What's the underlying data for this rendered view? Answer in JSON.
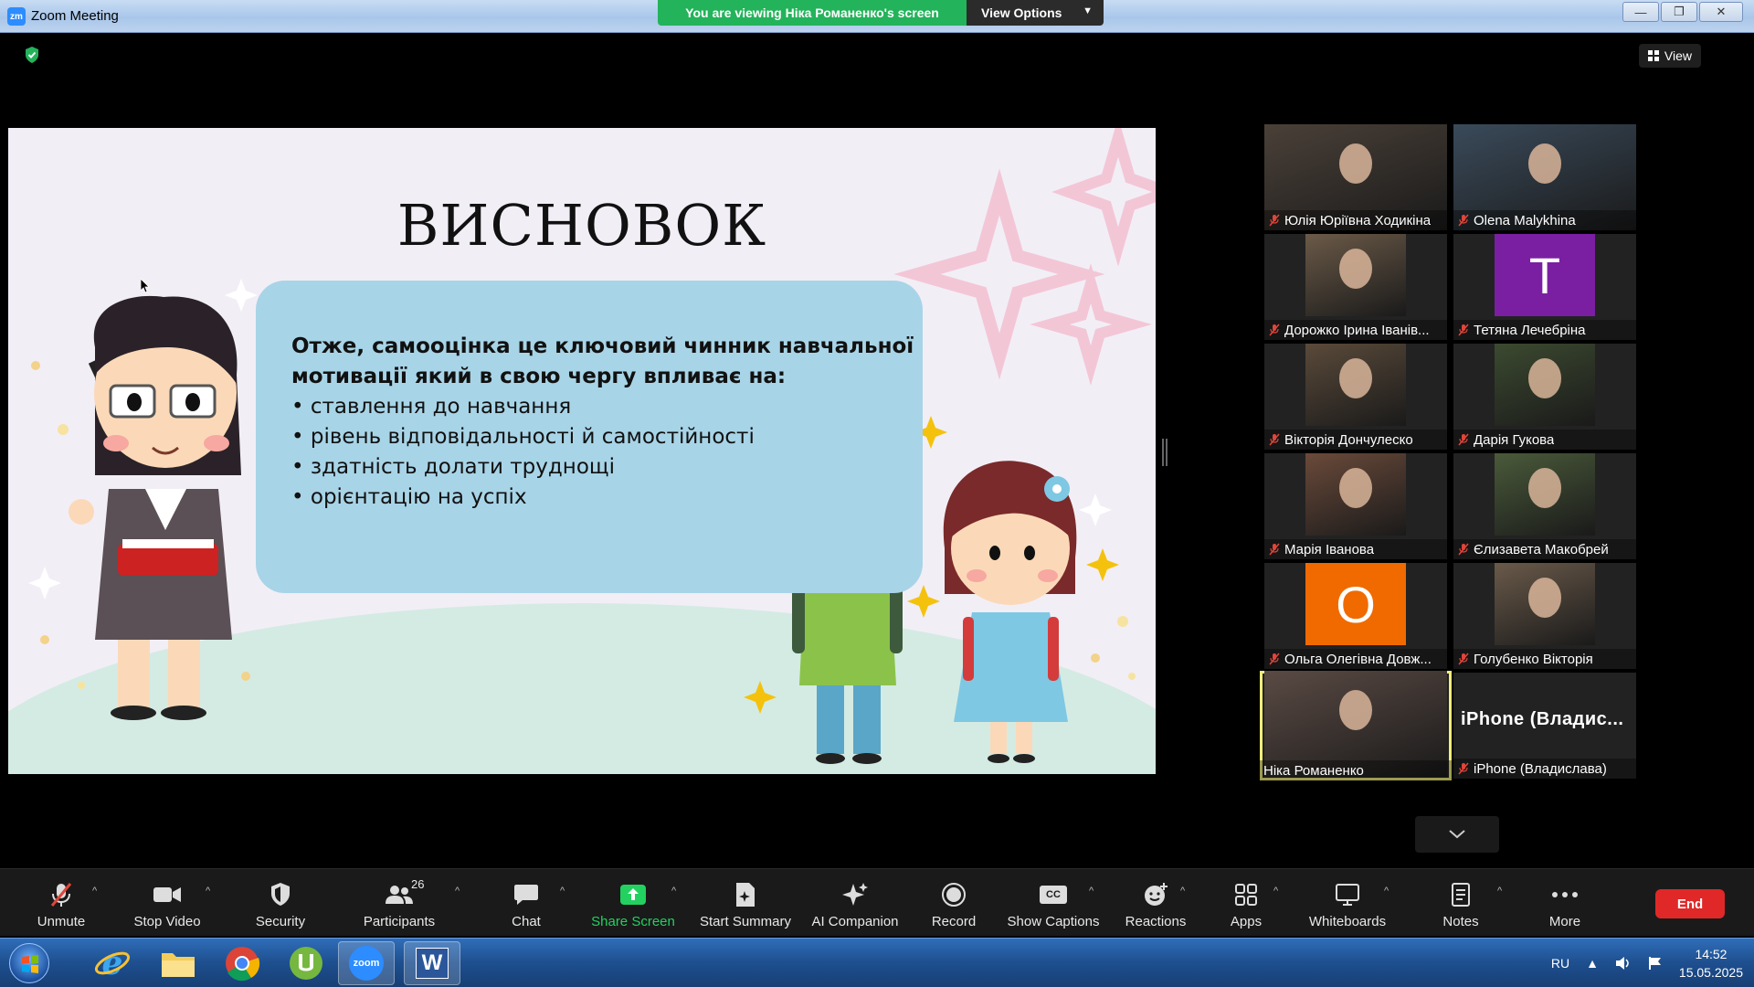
{
  "window": {
    "app_logo": "zm",
    "title": "Zoom Meeting",
    "viewing_banner": "You are viewing Ніка Романенко's screen",
    "view_options": "View Options",
    "view_button": "View"
  },
  "slide": {
    "title": "ВИСНОВОК",
    "lead": "Отже, самооцінка це ключовий чинник навчальної мотивації який в свою чергу впливає на:",
    "bullets": [
      "ставлення до навчання",
      "рівень відповідальності й самостійності",
      "здатність долати труднощі",
      "орієнтацію на успіх"
    ]
  },
  "gallery": {
    "participants": [
      {
        "name": "Юлія Юріївна Ходикіна",
        "kind": "video"
      },
      {
        "name": "Olena Malykhina",
        "kind": "video"
      },
      {
        "name": "Дорожко Ірина Іванів...",
        "kind": "video"
      },
      {
        "name": "Тетяна Лечебріна",
        "kind": "avatar",
        "letter": "T",
        "color": "#7a1fa2"
      },
      {
        "name": "Вікторія Дончулеско",
        "kind": "video"
      },
      {
        "name": "Дарія Гукова",
        "kind": "video"
      },
      {
        "name": "Марія Іванова",
        "kind": "video"
      },
      {
        "name": "Єлизавета Макобрей",
        "kind": "video"
      },
      {
        "name": "Ольга Олегівна Довж...",
        "kind": "avatar",
        "letter": "O",
        "color": "#f06a00"
      },
      {
        "name": "Голубенко Вікторія",
        "kind": "video"
      },
      {
        "name": "Ніка Романенко",
        "kind": "video",
        "active": true
      },
      {
        "name": "iPhone (Владислава)",
        "kind": "text",
        "big_name": "iPhone  (Владис..."
      }
    ]
  },
  "toolbar": {
    "unmute": "Unmute",
    "stop_video": "Stop Video",
    "security": "Security",
    "participants": "Participants",
    "participants_count": "26",
    "chat": "Chat",
    "share_screen": "Share Screen",
    "start_summary": "Start Summary",
    "ai_companion": "AI Companion",
    "record": "Record",
    "show_captions": "Show Captions",
    "captions_icon_text": "CC",
    "reactions": "Reactions",
    "apps": "Apps",
    "whiteboards": "Whiteboards",
    "notes": "Notes",
    "more": "More",
    "end": "End"
  },
  "taskbar": {
    "language": "RU",
    "time": "14:52",
    "date": "15.05.2025",
    "zoom_label": "zoom",
    "word_label": "W"
  },
  "colors": {
    "share_green": "#23d160",
    "end_red": "#e02828",
    "banner_green": "#23b35a",
    "active_outline": "#f1ee7b",
    "mute_red": "#e0453a"
  }
}
